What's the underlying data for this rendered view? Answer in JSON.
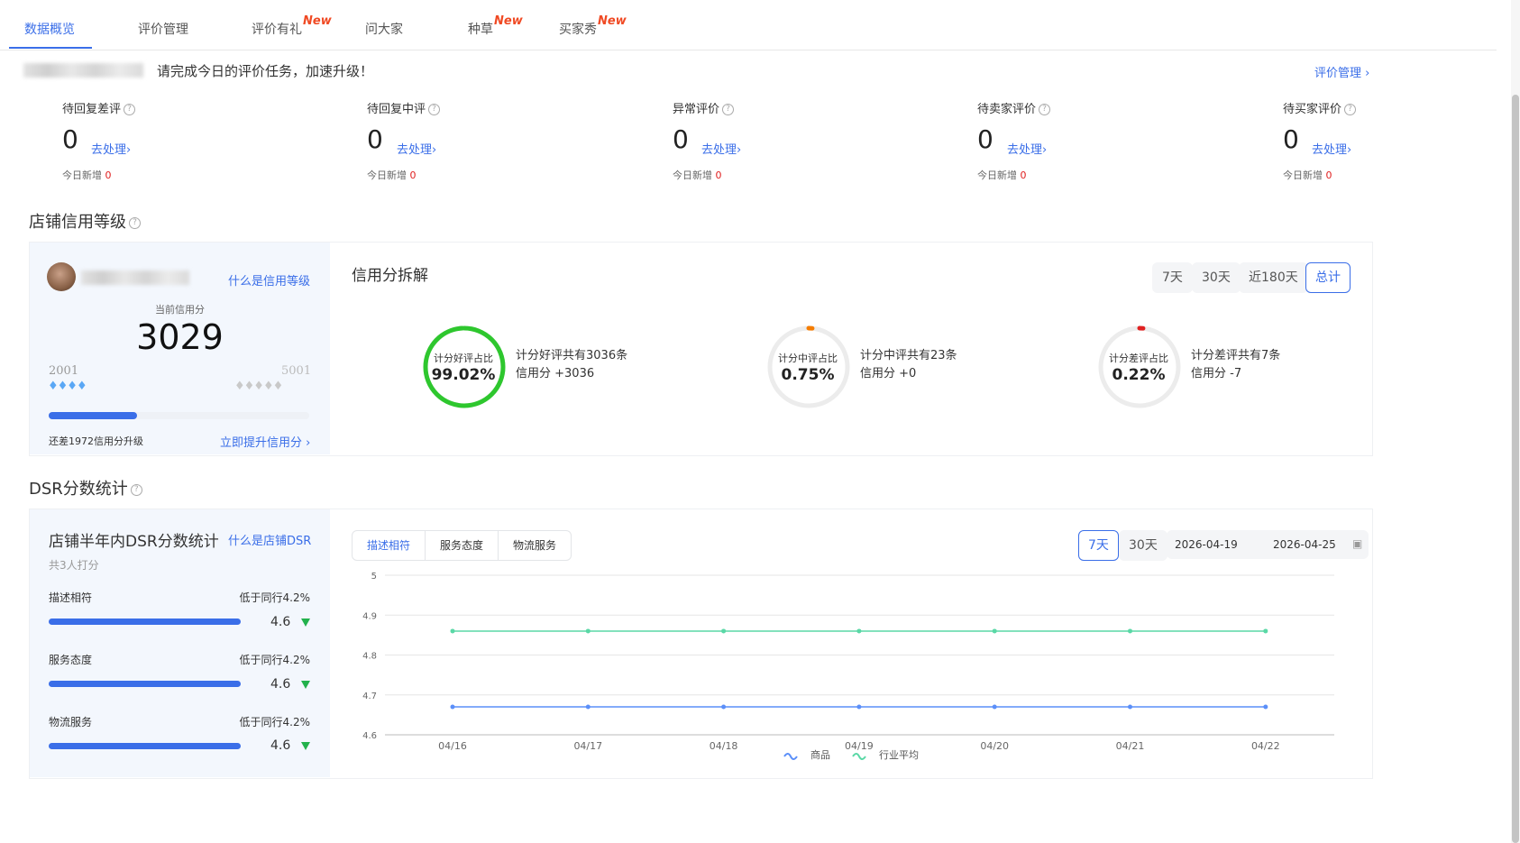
{
  "tabs": [
    {
      "label": "数据概览",
      "new": ""
    },
    {
      "label": "评价管理",
      "new": ""
    },
    {
      "label": "评价有礼",
      "new": "New"
    },
    {
      "label": "问大家",
      "new": ""
    },
    {
      "label": "种草",
      "new": "New"
    },
    {
      "label": "买家秀",
      "new": "New"
    }
  ],
  "notice": {
    "text": "请完成今日的评价任务，加速升级！",
    "link": "评价管理"
  },
  "stats": [
    {
      "label": "待回复差评",
      "value": "0",
      "action": "去处理",
      "today_label": "今日新增",
      "today": "0"
    },
    {
      "label": "待回复中评",
      "value": "0",
      "action": "去处理",
      "today_label": "今日新增",
      "today": "0"
    },
    {
      "label": "异常评价",
      "value": "0",
      "action": "去处理",
      "today_label": "今日新增",
      "today": "0"
    },
    {
      "label": "待卖家评价",
      "value": "0",
      "action": "去处理",
      "today_label": "今日新增",
      "today": "0"
    },
    {
      "label": "待买家评价",
      "value": "0",
      "action": "去处理",
      "today_label": "今日新增",
      "today": "0"
    }
  ],
  "credit": {
    "section_title": "店铺信用等级",
    "what_link": "什么是信用等级",
    "current_label": "当前信用分",
    "score": "3029",
    "min": "2001",
    "max": "5001",
    "progress": 0.34,
    "remain_text": "还差1972信用分升级",
    "upgrade_link": "立即提升信用分",
    "breakdown_title": "信用分拆解",
    "ranges": [
      "7天",
      "30天",
      "近180天",
      "总计"
    ],
    "active_range": "总计",
    "rings": [
      {
        "label": "计分好评占比",
        "value": "99.02%",
        "pct": 99.02,
        "color": "#2ec72e",
        "line1": "计分好评共有3036条",
        "line2": "信用分 +3036"
      },
      {
        "label": "计分中评占比",
        "value": "0.75%",
        "pct": 0.75,
        "color": "#f57c00",
        "line1": "计分中评共有23条",
        "line2": "信用分 +0"
      },
      {
        "label": "计分差评占比",
        "value": "0.22%",
        "pct": 0.22,
        "color": "#e02020",
        "line1": "计分差评共有7条",
        "line2": "信用分 -7"
      }
    ]
  },
  "dsr": {
    "section_title": "DSR分数统计",
    "panel_title": "店铺半年内DSR分数统计",
    "what_link": "什么是店铺DSR",
    "raters": "共3人打分",
    "items": [
      {
        "name": "描述相符",
        "compare": "低于同行4.2%",
        "score": "4.6",
        "pct": 0.92
      },
      {
        "name": "服务态度",
        "compare": "低于同行4.2%",
        "score": "4.6",
        "pct": 0.92
      },
      {
        "name": "物流服务",
        "compare": "低于同行4.2%",
        "score": "4.6",
        "pct": 0.92
      }
    ],
    "tabs": [
      "描述相符",
      "服务态度",
      "物流服务"
    ],
    "active_tab": "描述相符",
    "ranges": [
      "7天",
      "30天"
    ],
    "active_range": "7天",
    "date_start": "2026-04-19",
    "date_end": "2026-04-25"
  },
  "chart_data": {
    "type": "line",
    "x": [
      "04/16",
      "04/17",
      "04/18",
      "04/19",
      "04/20",
      "04/21",
      "04/22"
    ],
    "series": [
      {
        "name": "商品",
        "color": "#5b8ff9",
        "values": [
          4.67,
          4.67,
          4.67,
          4.67,
          4.67,
          4.67,
          4.67
        ]
      },
      {
        "name": "行业平均",
        "color": "#5ad8a6",
        "values": [
          4.86,
          4.86,
          4.86,
          4.86,
          4.86,
          4.86,
          4.86
        ]
      }
    ],
    "yticks": [
      "4.6",
      "4.7",
      "4.8",
      "4.9",
      "5"
    ],
    "ylim": [
      4.6,
      5.0
    ],
    "grid": true,
    "legend": "bottom"
  }
}
